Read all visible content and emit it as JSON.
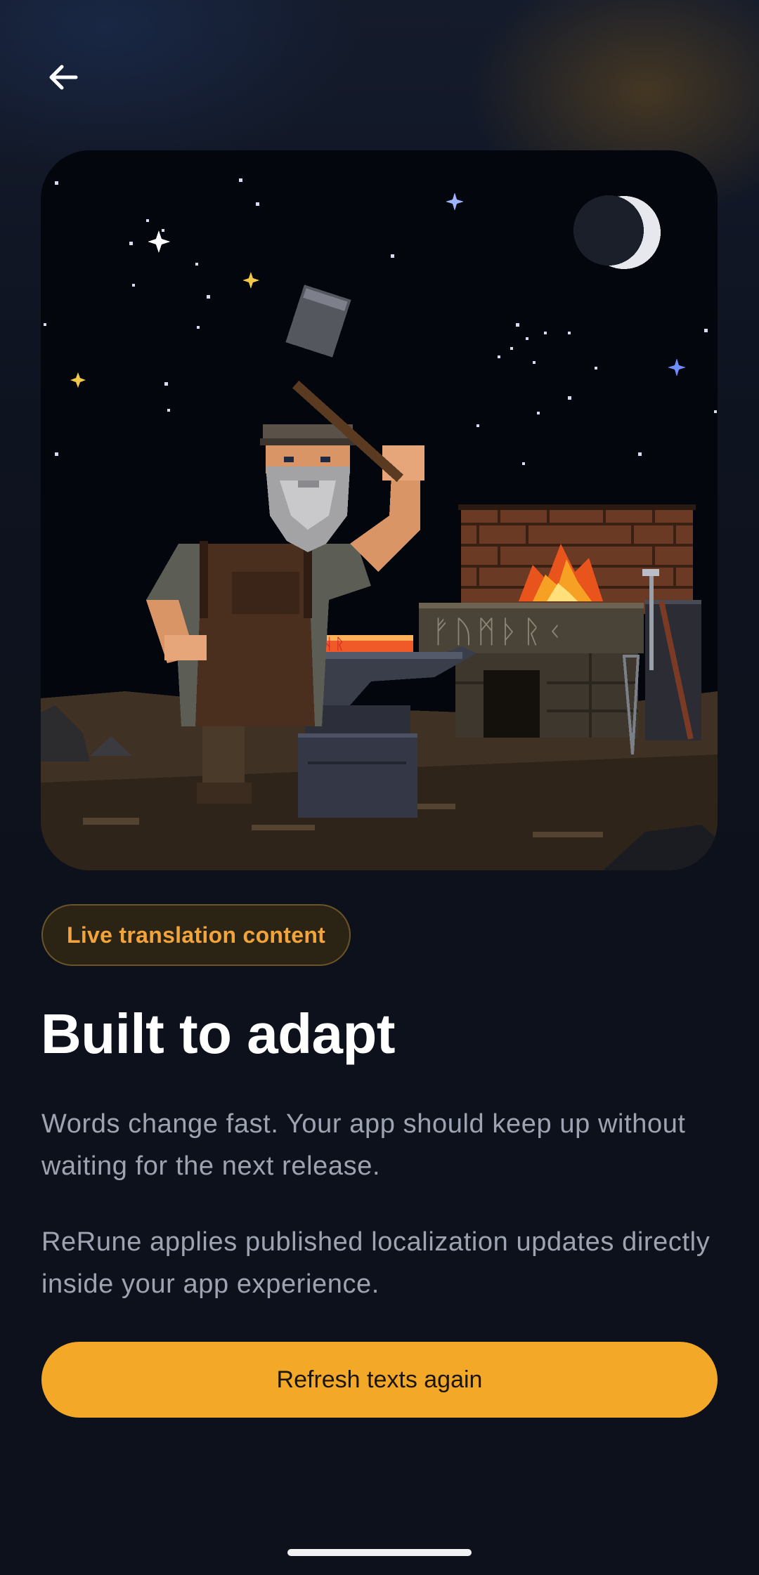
{
  "nav": {
    "back_icon": "arrow-left-icon"
  },
  "hero": {
    "illustration": "pixel-art dwarf blacksmith forging at anvil under night sky",
    "forge_runes": "ᚠᚢᛗᚦᚱᚲ",
    "blade_runes": "ᚠᚱᛗᚺᚱ"
  },
  "badge": {
    "label": "Live translation content"
  },
  "title": "Built to adapt",
  "paragraphs": [
    "Words change fast. Your app should keep up without waiting for the next release.",
    "ReRune applies published localization updates directly inside your app experience."
  ],
  "cta": {
    "label": "Refresh texts again"
  },
  "colors": {
    "background": "#0d111b",
    "accent": "#f4a828",
    "badge_text": "#f2a43a",
    "title": "#ffffff",
    "body_text": "#9ea3b2"
  }
}
